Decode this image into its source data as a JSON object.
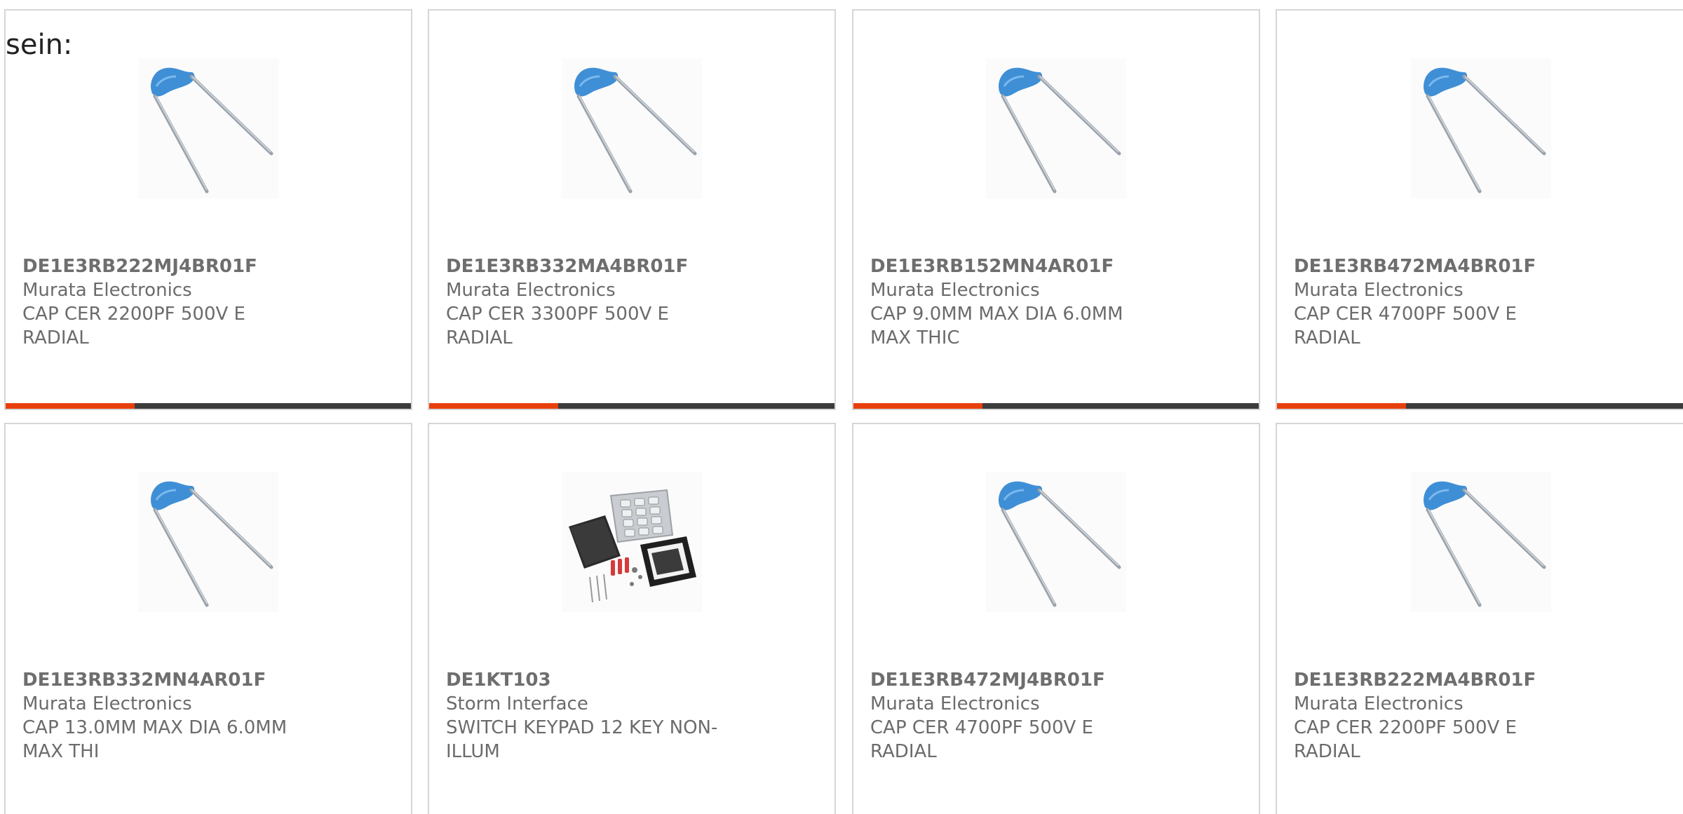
{
  "lead_text": "sein:",
  "colors": {
    "accent": "#e8400c",
    "bar": "#3c3c3c",
    "card_border": "#d6d6d6",
    "capacitor_blue": "#3f8fd6"
  },
  "products": [
    {
      "part_number": "DE1E3RB222MJ4BR01F",
      "manufacturer": "Murata Electronics",
      "description": "CAP CER 2200PF 500V E RADIAL",
      "image_icon": "ceramic-capacitor-icon"
    },
    {
      "part_number": "DE1E3RB332MA4BR01F",
      "manufacturer": "Murata Electronics",
      "description": "CAP CER 3300PF 500V E RADIAL",
      "image_icon": "ceramic-capacitor-icon"
    },
    {
      "part_number": "DE1E3RB152MN4AR01F",
      "manufacturer": "Murata Electronics",
      "description": "CAP 9.0MM MAX DIA 6.0MM MAX THIC",
      "image_icon": "ceramic-capacitor-icon"
    },
    {
      "part_number": "DE1E3RB472MA4BR01F",
      "manufacturer": "Murata Electronics",
      "description": "CAP CER 4700PF 500V E RADIAL",
      "image_icon": "ceramic-capacitor-icon"
    },
    {
      "part_number": "DE1E3RB332MN4AR01F",
      "manufacturer": "Murata Electronics",
      "description": "CAP 13.0MM MAX DIA 6.0MM MAX THI",
      "image_icon": "ceramic-capacitor-icon"
    },
    {
      "part_number": "DE1KT103",
      "manufacturer": "Storm Interface",
      "description": "SWITCH KEYPAD 12 KEY NON-ILLUM",
      "image_icon": "keypad-kit-icon"
    },
    {
      "part_number": "DE1E3RB472MJ4BR01F",
      "manufacturer": "Murata Electronics",
      "description": "CAP CER 4700PF 500V E RADIAL",
      "image_icon": "ceramic-capacitor-icon"
    },
    {
      "part_number": "DE1E3RB222MA4BR01F",
      "manufacturer": "Murata Electronics",
      "description": "CAP CER 2200PF 500V E RADIAL",
      "image_icon": "ceramic-capacitor-icon"
    }
  ]
}
